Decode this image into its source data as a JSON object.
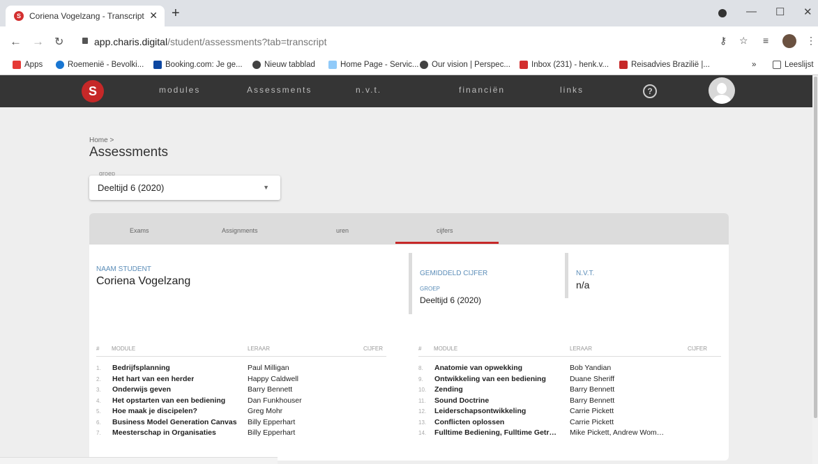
{
  "browser": {
    "tab_title": "Coriena Vogelzang - Transcript",
    "url_host": "app.charis.digital",
    "url_path": "/student/assessments?tab=transcript",
    "bookmarks": [
      {
        "label": "Apps",
        "color": "#e53935"
      },
      {
        "label": "Roemenië - Bevolki...",
        "color": "#1976d2"
      },
      {
        "label": "Booking.com: Je ge...",
        "color": "#0d47a1"
      },
      {
        "label": "Nieuw tabblad",
        "color": "#424242"
      },
      {
        "label": "Home Page - Servic...",
        "color": "#90caf9"
      },
      {
        "label": "Our vision | Perspec...",
        "color": "#424242"
      },
      {
        "label": "Inbox (231) - henk.v...",
        "color": "#d32f2f"
      },
      {
        "label": "Reisadvies Brazilië |...",
        "color": "#c62828"
      }
    ],
    "reading_list": "Leeslijst"
  },
  "header": {
    "menu": [
      "modules",
      "Assessments",
      "n.v.t.",
      "financiën",
      "links"
    ],
    "help": "?"
  },
  "page": {
    "breadcrumb": "Home >",
    "title": "Assessments",
    "group_label": "groep",
    "group_value": "Deeltijd 6 (2020)"
  },
  "tabs": [
    "Exams",
    "Assignments",
    "uren",
    "cijfers"
  ],
  "student": {
    "name_label": "NAAM STUDENT",
    "name": "Coriena Vogelzang",
    "avg_label": "GEMIDDELD CIJFER",
    "group_label": "GROEP",
    "group": "Deeltijd 6 (2020)",
    "nvt_label": "N.V.T.",
    "nvt": "n/a"
  },
  "table_headers": {
    "num": "#",
    "module": "MODULE",
    "teacher": "LERAAR",
    "grade": "CIJFER"
  },
  "left_rows": [
    {
      "n": "1.",
      "module": "Bedrijfsplanning",
      "teacher": "Paul Milligan"
    },
    {
      "n": "2.",
      "module": "Het hart van een herder",
      "teacher": "Happy Caldwell"
    },
    {
      "n": "3.",
      "module": "Onderwijs geven",
      "teacher": "Barry Bennett"
    },
    {
      "n": "4.",
      "module": "Het opstarten van een bediening",
      "teacher": "Dan Funkhouser"
    },
    {
      "n": "5.",
      "module": "Hoe maak je discipelen?",
      "teacher": "Greg Mohr"
    },
    {
      "n": "6.",
      "module": "Business Model Generation Canvas",
      "teacher": "Billy Epperhart"
    },
    {
      "n": "7.",
      "module": "Meesterschap in Organisaties",
      "teacher": "Billy Epperhart"
    }
  ],
  "right_rows": [
    {
      "n": "8.",
      "module": "Anatomie van opwekking",
      "teacher": "Bob Yandian"
    },
    {
      "n": "9.",
      "module": "Ontwikkeling van een bediening",
      "teacher": "Duane Sheriff"
    },
    {
      "n": "10.",
      "module": "Zending",
      "teacher": "Barry Bennett"
    },
    {
      "n": "11.",
      "module": "Sound Doctrine",
      "teacher": "Barry Bennett"
    },
    {
      "n": "12.",
      "module": "Leiderschapsontwikkeling",
      "teacher": "Carrie Pickett"
    },
    {
      "n": "13.",
      "module": "Conflicten oplossen",
      "teacher": "Carrie Pickett"
    },
    {
      "n": "14.",
      "module": "Fulltime Bediening, Fulltime Getr…",
      "teacher": "Mike Pickett, Andrew Wom…"
    }
  ]
}
